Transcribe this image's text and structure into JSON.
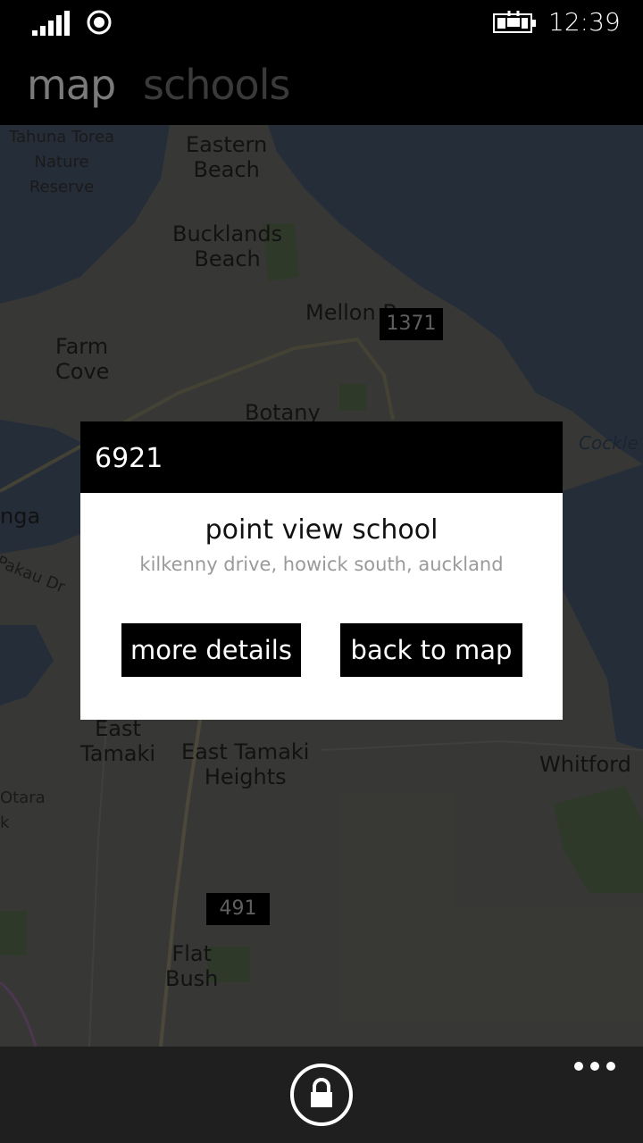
{
  "status_bar": {
    "time": "12:39",
    "icons": [
      "signal-strength-icon",
      "wifi-icon",
      "battery-charging-icon"
    ]
  },
  "pivot": {
    "tabs": [
      {
        "label": "map",
        "active": true
      },
      {
        "label": "schools",
        "active": false
      }
    ]
  },
  "map": {
    "labels": {
      "tahuna": "Tahuna Torea\nNature\nReserve",
      "eastern_beach": "Eastern\nBeach",
      "bucklands_beach": "Bucklands\nBeach",
      "mellon": "Mellon B",
      "farm_cove": "Farm\nCove",
      "botany": "Botany",
      "cockle": "Cockle",
      "nga": "nga",
      "pakau_dr": "Pakau Dr",
      "east_tamaki": "East\nTamaki",
      "east_tamaki_heights": "East Tamaki\nHeights",
      "whitford": "Whitford",
      "otara": "Otara\nk",
      "flat_bush": "Flat\nBush"
    },
    "road_shields": {
      "r1371": "1371",
      "r491": "491"
    },
    "colors": {
      "land": "#5a5a56",
      "water": "#3d4a5c",
      "park": "#4d5c45"
    }
  },
  "popup": {
    "id": "6921",
    "school_name": "point view school",
    "address": "kilkenny drive, howick south, auckland",
    "more_details_label": "more details",
    "back_to_map_label": "back to map"
  },
  "app_bar": {
    "primary_icon": "lock-icon",
    "more_icon": "ellipsis-icon"
  }
}
